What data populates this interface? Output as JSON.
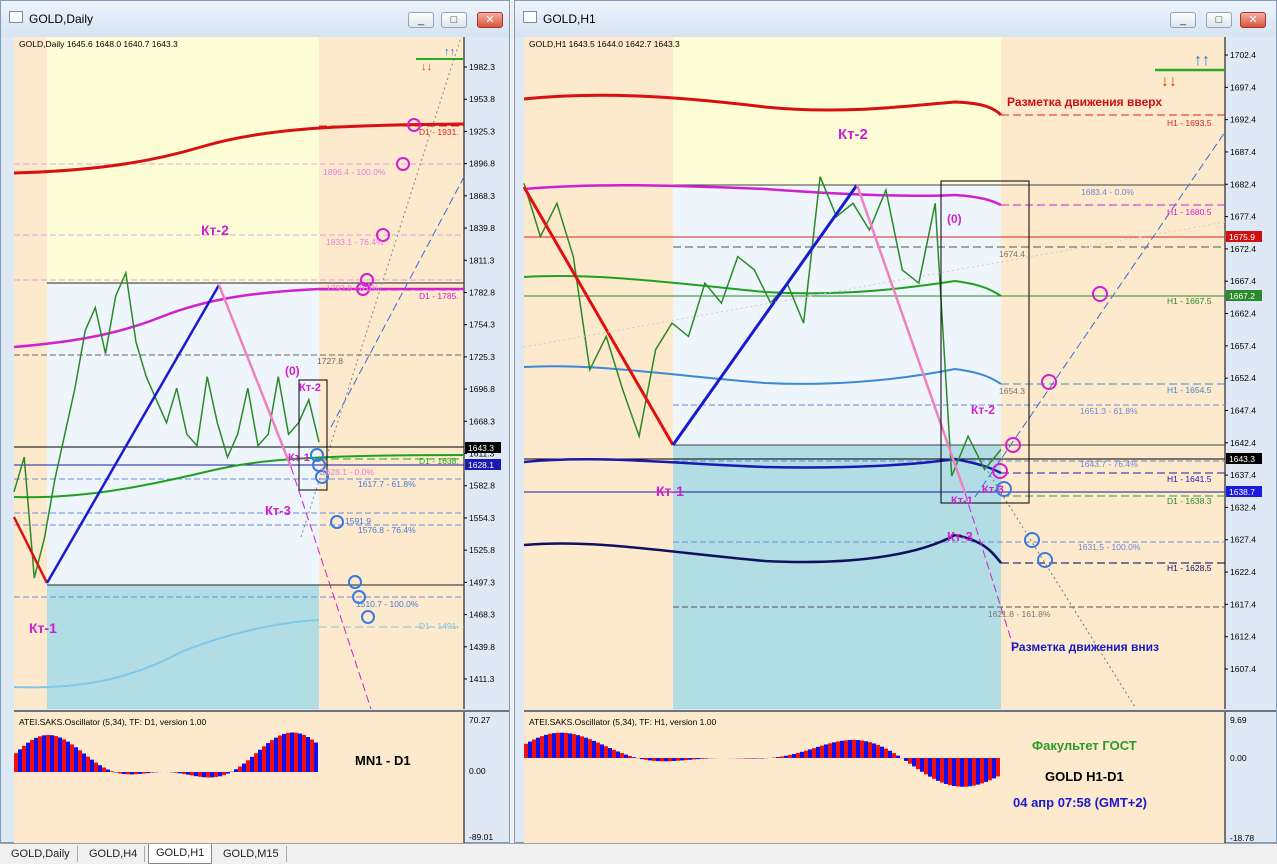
{
  "tabs": [
    "GOLD,Daily",
    "GOLD,H4",
    "GOLD,H1",
    "GOLD,M15"
  ],
  "active_tab": 2,
  "window_buttons": {
    "minimize": "_",
    "restore": "□",
    "close": "✕"
  },
  "left": {
    "window_title": "GOLD,Daily",
    "info": "GOLD,Daily  1645.6 1648.0 1640.7 1643.3",
    "price_labels": [
      "1982.3",
      "1953.8",
      "1925.3",
      "1896.8",
      "1868.3",
      "1839.8",
      "1811.3",
      "1782.8",
      "1754.3",
      "1725.3",
      "1696.8",
      "1668.3",
      "1611.3",
      "1582.8",
      "1554.3",
      "1525.8",
      "1497.3",
      "1468.3",
      "1439.8",
      "1411.3"
    ],
    "current_price": "1643.3",
    "blue_price": "1628.1",
    "line_labels": {
      "d1_1931": "D1 - 1931.",
      "d1_1785": "D1 - 1785.",
      "d1_1638": "D1 - 1638.",
      "d1_1491": "D1 - 1491."
    },
    "fib_labels": {
      "f1896": "1896.4 - 100.0%",
      "f1833": "1833.1 - 76.4%",
      "f0": "1793.8 - 0.0%",
      "f1727": "1727.8",
      "f1628": "1628.1 - 0.0%",
      "f1617": "1617.7 - 61.8%",
      "f1591": "1591.9",
      "f1576": "1576.8 - 76.4%",
      "f1510": "1510.7 - 100.0%"
    },
    "annotations": {
      "kt1": "Кт-1",
      "kt2_big": "Кт-2",
      "kt2_small": "Кт-2",
      "kt1_small": "Кт-1",
      "kt3": "Кт-3",
      "zero": "(0)"
    },
    "osc_title": "ATEI.SAKS.Oscillator (5,34), TF: D1, version 1.00",
    "osc_labels": [
      "70.27",
      "0.00",
      "-89.01"
    ],
    "osc_caption": "MN1 - D1"
  },
  "right": {
    "window_title": "GOLD,H1",
    "info": "GOLD,H1  1643.5 1644.0 1642.7 1643.3",
    "price_labels": [
      "1702.4",
      "1697.4",
      "1692.4",
      "1687.4",
      "1682.4",
      "1677.4",
      "1672.4",
      "1667.4",
      "1662.4",
      "1657.4",
      "1652.4",
      "1647.4",
      "1642.4",
      "1637.4",
      "1632.4",
      "1627.4",
      "1622.4",
      "1617.4",
      "1612.4",
      "1607.4"
    ],
    "current_price": "1643.3",
    "red_price": "1675.9",
    "green_price": "1667.2",
    "blue_price": "1638.7",
    "line_labels": {
      "h1693": "H1 - 1693.5",
      "h1680": "H1 - 1680.5",
      "h1667": "H1 - 1667.5",
      "h1654": "H1 - 1654.5",
      "h1641": "H1 - 1641.5",
      "d1638": "D1 - 1638.3",
      "h1628": "H1 - 1628.5"
    },
    "fib_labels": {
      "f1683": "1683.4 - 0.0%",
      "f1674": "1674.4",
      "f1654": "1654.3",
      "f1651": "1651.3 - 61.8%",
      "f1643": "1643.7 - 76.4%",
      "f1631": "1631.5 - 100.0%",
      "f1621": "1621.8 - 161.8%"
    },
    "annotations": {
      "kt1_big": "Кт-1",
      "kt2_big": "Кт-2",
      "zero": "(0)",
      "kt2_small": "Кт-2",
      "kt1_small": "Кт-1",
      "kt3_small": "Кт-3",
      "kt3_big": "Кт-3",
      "up_text": "Разметка движения вверх",
      "down_text": "Разметка движения вниз"
    },
    "osc_title": "ATEI.SAKS.Oscillator (5,34), TF: H1, version 1.00",
    "osc_labels": [
      "9.69",
      "0.00",
      "-18.78"
    ],
    "caption_faculty": "Факультет ГОСТ",
    "caption_pair": "GOLD   H1-D1",
    "caption_time": "04 апр 07:58  (GMT+2)"
  },
  "chart_data": [
    {
      "type": "line",
      "title": "GOLD,Daily",
      "ylim": [
        1411.3,
        1995
      ],
      "series": [
        {
          "name": "",
          "x": [
            0,
            10,
            20,
            30,
            40,
            50,
            60,
            70,
            80,
            90,
            100,
            110,
            120,
            130,
            140,
            150,
            160,
            170,
            180,
            190,
            200,
            210,
            220,
            230,
            240,
            250,
            260,
            270,
            280,
            290,
            300
          ],
          "values": [
            1600,
            1630,
            1525,
            1560,
            1610,
            1650,
            1690,
            1740,
            1760,
            1720,
            1770,
            1790,
            1730,
            1700,
            1680,
            1660,
            1690,
            1650,
            1640,
            1700,
            1660,
            1630,
            1650,
            1690,
            1640,
            1650,
            1700,
            1650,
            1660,
            1680,
            1643
          ]
        }
      ]
    },
    {
      "type": "line",
      "title": "GOLD,H1",
      "ylim": [
        1604,
        1705
      ],
      "series": [
        {
          "name": "",
          "x": [
            0,
            10,
            20,
            30,
            40,
            50,
            60,
            70,
            80,
            90,
            100,
            110,
            120,
            130,
            140,
            150,
            160,
            170,
            180,
            190,
            200,
            210,
            220,
            230,
            240,
            250,
            260,
            270,
            280,
            290
          ],
          "values": [
            1683,
            1675,
            1680,
            1672,
            1655,
            1660,
            1652,
            1645,
            1658,
            1662,
            1660,
            1668,
            1665,
            1672,
            1670,
            1665,
            1668,
            1662,
            1684,
            1678,
            1680,
            1676,
            1682,
            1670,
            1668,
            1680,
            1639,
            1645,
            1640,
            1643
          ]
        }
      ]
    }
  ]
}
